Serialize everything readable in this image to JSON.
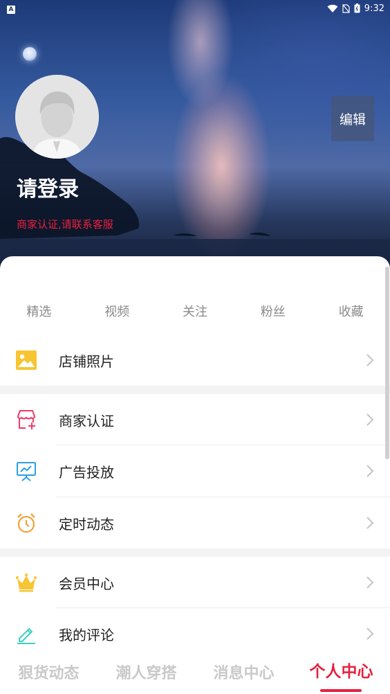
{
  "status_bar": {
    "time": "9:32",
    "notification_icon": "a-badge-icon",
    "letter": "A"
  },
  "profile": {
    "login_prompt": "请登录",
    "merchant_note": "商家认证,请联系客服",
    "edit_label": "编辑"
  },
  "stats": [
    "精选",
    "视频",
    "关注",
    "粉丝",
    "收藏"
  ],
  "menu": {
    "store_photos": "店铺照片",
    "merchant_verify": "商家认证",
    "advertising": "广告投放",
    "scheduled_posts": "定时动态",
    "member_center": "会员中心",
    "my_comments": "我的评论"
  },
  "bottom_nav": {
    "tabs": [
      "狠货动态",
      "潮人穿搭",
      "消息中心",
      "个人中心"
    ],
    "active": "个人中心"
  },
  "colors": {
    "accent": "#e8203e",
    "icon_yellow": "#f7c531",
    "icon_pink": "#ef3a64",
    "icon_blue": "#2a9ee8",
    "icon_orange": "#f59a23",
    "icon_teal": "#3fcfc3"
  }
}
